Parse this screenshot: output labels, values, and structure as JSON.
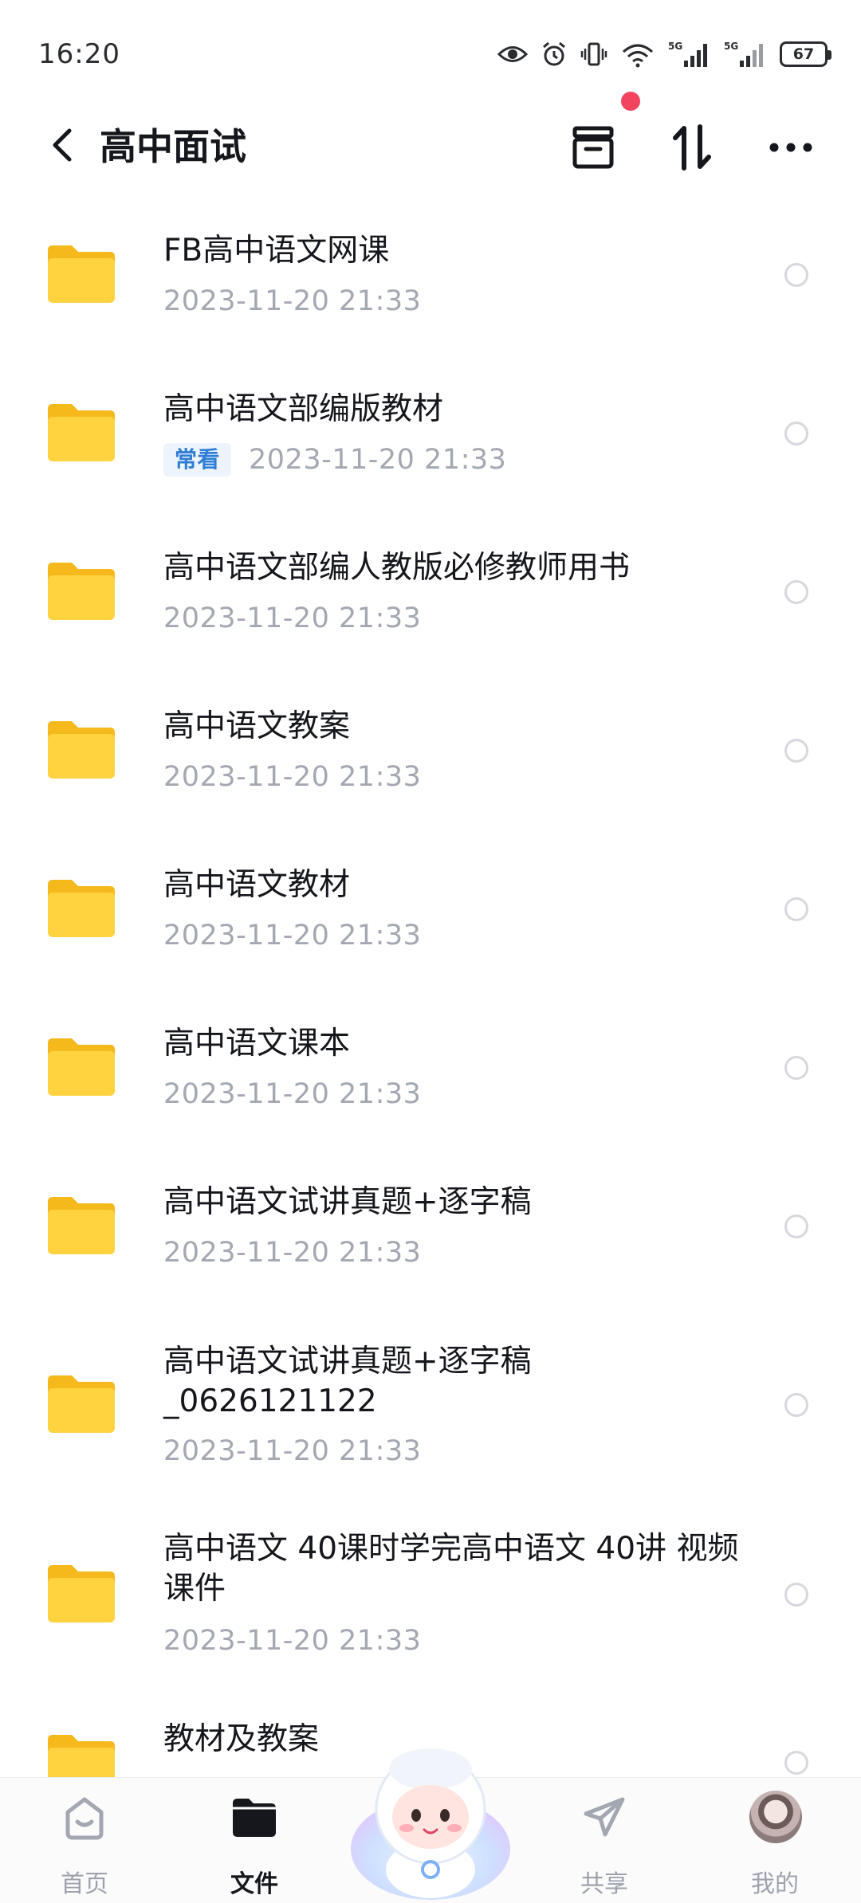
{
  "status_bar": {
    "time": "16:20",
    "battery": "67"
  },
  "header": {
    "title": "高中面试"
  },
  "files": [
    {
      "name": "FB高中语文网课",
      "date": "2023-11-20  21:33",
      "tag": ""
    },
    {
      "name": "高中语文部编版教材",
      "date": "2023-11-20  21:33",
      "tag": "常看"
    },
    {
      "name": "高中语文部编人教版必修教师用书",
      "date": "2023-11-20  21:33",
      "tag": ""
    },
    {
      "name": "高中语文教案",
      "date": "2023-11-20  21:33",
      "tag": ""
    },
    {
      "name": "高中语文教材",
      "date": "2023-11-20  21:33",
      "tag": ""
    },
    {
      "name": "高中语文课本",
      "date": "2023-11-20  21:33",
      "tag": ""
    },
    {
      "name": "高中语文试讲真题+逐字稿",
      "date": "2023-11-20  21:33",
      "tag": ""
    },
    {
      "name": "高中语文试讲真题+逐字稿\n_0626121122",
      "date": "2023-11-20  21:33",
      "tag": ""
    },
    {
      "name": "高中语文 40课时学完高中语文 40讲 视频课件",
      "date": "2023-11-20  21:33",
      "tag": ""
    },
    {
      "name": "教材及教案",
      "date": "",
      "tag": ""
    }
  ],
  "bottom_nav": [
    {
      "label": "首页",
      "icon": "home-icon",
      "active": false
    },
    {
      "label": "文件",
      "icon": "folder-icon",
      "active": true
    },
    {
      "label": "共享",
      "icon": "send-icon",
      "active": false
    },
    {
      "label": "我的",
      "icon": "avatar",
      "active": false
    }
  ],
  "colors": {
    "accent": "#2f7ed6",
    "badge": "#f2445f",
    "folder": "#ffd23f",
    "muted": "#a4a8b3"
  }
}
